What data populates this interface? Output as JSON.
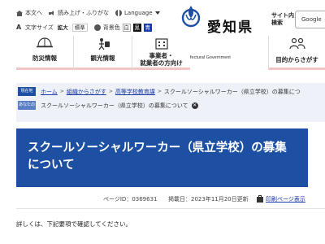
{
  "utility": {
    "text_version": "本文へ",
    "read_aloud": "読み上げ・ふりがな",
    "language": "Language",
    "font_size_label": "文字サイズ",
    "font_large": "拡大",
    "font_standard": "標準",
    "bg_color_label": "背景色",
    "bg_white": "白",
    "bg_black": "黒",
    "bg_blue": "青"
  },
  "logo": {
    "name": "愛知県",
    "english": "Aichi Prefectural Government"
  },
  "search": {
    "label_line1": "サイト内",
    "label_line2": "検索",
    "box_text": "Google"
  },
  "nav": {
    "items": [
      {
        "label": "防災情報",
        "icon": "helmet-icon"
      },
      {
        "label": "観光情報",
        "icon": "tourist-icon"
      },
      {
        "label_line1": "事業者・",
        "label_line2": "就業者の方向け",
        "icon": "building-icon"
      },
      {
        "label": "目的からさがす",
        "icon": "people-icon"
      }
    ]
  },
  "breadcrumb": {
    "current_tag": "現在地",
    "path": [
      "ホーム",
      "組織からさがす",
      "高等学校教育課",
      "スクールソーシャルワーカー（県立学校）の募集につ"
    ],
    "now_tag": "あなたの",
    "now_text": "スクールソーシャルワーカー（県立学校）の募集について"
  },
  "page": {
    "title": "スクールソーシャルワーカー（県立学校）の募集について",
    "page_id": "ページID：0369631",
    "updated": "掲載日：2023年11月20日更新",
    "print": "印刷ページ表示",
    "body_intro": "詳しくは、下記要項で確認してください。"
  },
  "colors": {
    "title_bg": "#1d4fa3",
    "link": "#1a3aa8",
    "breadcrumb_bg": "#eef2f8"
  }
}
